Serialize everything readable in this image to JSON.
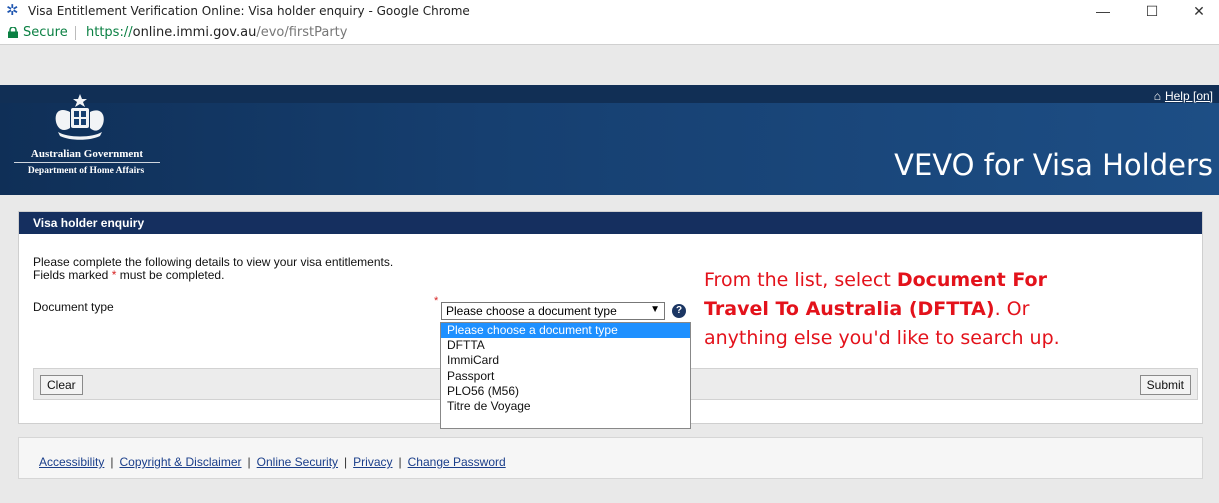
{
  "browser": {
    "title": "Visa Entitlement Verification Online: Visa holder enquiry - Google Chrome",
    "secure_label": "Secure",
    "url_scheme": "https://",
    "url_host": "online.immi.gov.au",
    "url_path": "/evo/firstParty",
    "minimize": "—",
    "maximize": "☐",
    "close": "✕"
  },
  "header": {
    "help_label": "Help [on]",
    "gov_line1": "Australian Government",
    "gov_line2": "Department of Home Affairs",
    "app_title": "VEVO for Visa Holders"
  },
  "panel": {
    "title": "Visa holder enquiry",
    "intro_line1": "Please complete the following details to view your visa entitlements.",
    "intro_line2_a": "Fields marked ",
    "intro_line2_star": "*",
    "intro_line2_b": " must be completed.",
    "document_type_label": "Document type",
    "select_value": "Please choose a document type",
    "help_glyph": "?",
    "clear_label": "Clear",
    "submit_label": "Submit"
  },
  "dropdown": {
    "options": [
      "Please choose a document type",
      "DFTTA",
      "ImmiCard",
      "Passport",
      "PLO56 (M56)",
      "Titre de Voyage"
    ],
    "selected_index": 0
  },
  "annotation": {
    "part1": "From the list, select ",
    "bold": "Document For Travel To Australia (DFTTA)",
    "part2": ". Or anything else you'd like to search up."
  },
  "footer": {
    "links": [
      "Accessibility",
      "Copyright & Disclaimer",
      "Online Security",
      "Privacy",
      "Change Password"
    ]
  },
  "colors": {
    "banner": "#163f70",
    "panel_head": "#152f5f",
    "annotation_red": "#e3121b",
    "selected_option": "#1e90ff"
  }
}
